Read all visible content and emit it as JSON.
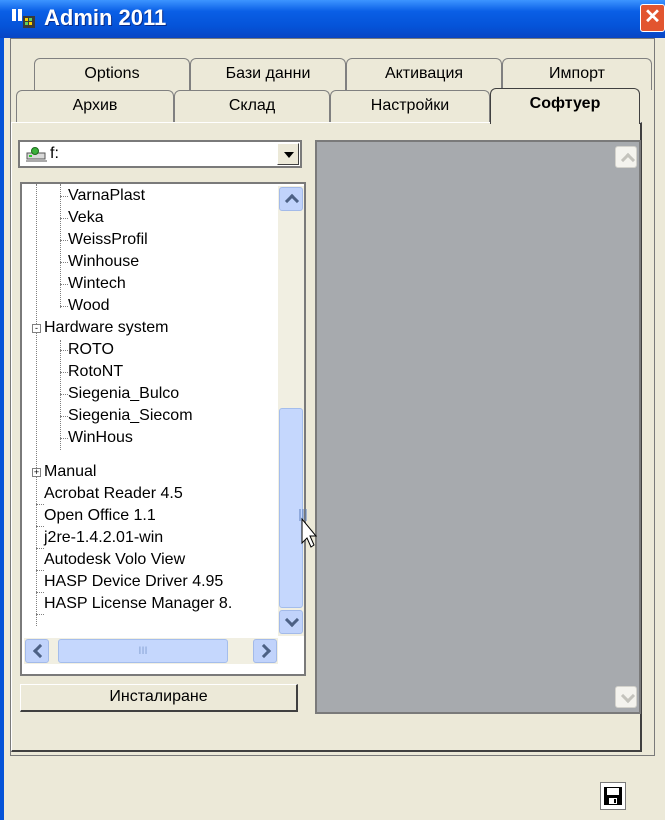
{
  "window": {
    "title": "Admin 2011",
    "close_glyph": "✕"
  },
  "tabs_top": [
    {
      "label": "Options"
    },
    {
      "label": "Бази данни"
    },
    {
      "label": "Активация"
    },
    {
      "label": "Импорт"
    }
  ],
  "tabs_bottom": [
    {
      "label": "Архив"
    },
    {
      "label": "Склад"
    },
    {
      "label": "Настройки"
    },
    {
      "label": "Софтуер",
      "active": true
    }
  ],
  "drive_combo": {
    "value": "f:",
    "icon": "network-drive-icon"
  },
  "tree": {
    "items": [
      {
        "label": "VarnaPlast",
        "level": 2
      },
      {
        "label": "Veka",
        "level": 2
      },
      {
        "label": "WeissProfil",
        "level": 2
      },
      {
        "label": "Winhouse",
        "level": 2
      },
      {
        "label": "Wintech",
        "level": 2
      },
      {
        "label": "Wood",
        "level": 2
      },
      {
        "label": "Hardware system",
        "level": 1,
        "expander": "-"
      },
      {
        "label": "ROTO",
        "level": 2
      },
      {
        "label": "RotoNT",
        "level": 2
      },
      {
        "label": "Siegenia_Bulco",
        "level": 2
      },
      {
        "label": "Siegenia_Siecom",
        "level": 2
      },
      {
        "label": "WinHous",
        "level": 2
      },
      {
        "label": "Manual",
        "level": 1,
        "expander": "+"
      },
      {
        "label": "Acrobat Reader 4.5",
        "level": 1
      },
      {
        "label": "Open Office 1.1",
        "level": 1
      },
      {
        "label": "j2re-1.4.2.01-win",
        "level": 1
      },
      {
        "label": "Autodesk Volo View",
        "level": 1
      },
      {
        "label": "HASP Device Driver 4.95",
        "level": 1
      },
      {
        "label": "HASP License Manager 8.",
        "level": 1
      }
    ],
    "hscroll_grip": "III"
  },
  "install_button": {
    "label": "Инсталиране"
  },
  "save_button": {
    "icon": "floppy-disk-icon"
  },
  "colors": {
    "titlebar": "#0553d8",
    "preview_bg": "#a7aaae",
    "window_bg": "#ece9d8"
  }
}
